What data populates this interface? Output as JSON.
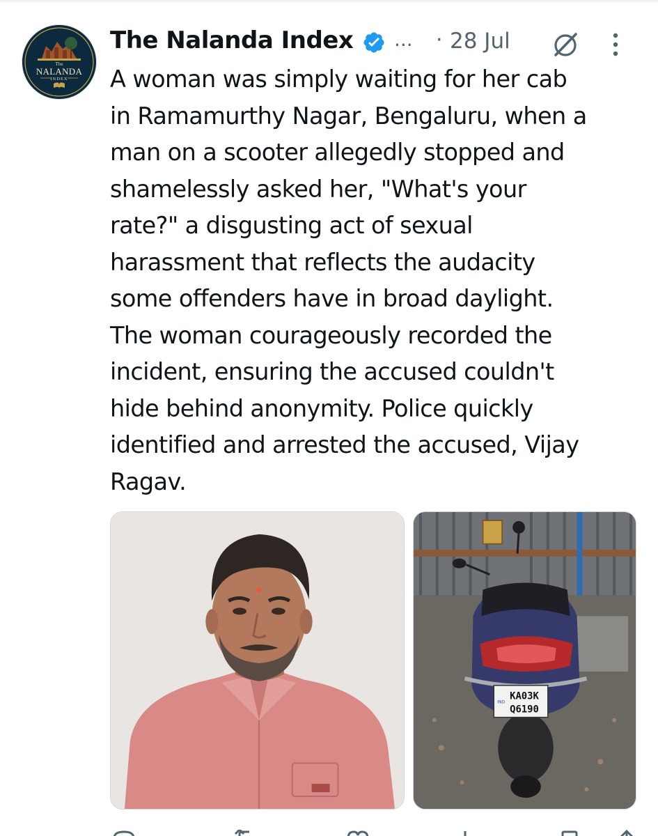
{
  "tweet": {
    "author_name": "The Nalanda Index",
    "handle_truncated": "...",
    "separator": "·",
    "date": "28 Jul",
    "text_lines": [
      "A woman was simply waiting for her cab",
      "in Ramamurthy Nagar, Bengaluru, when a",
      "man on a scooter allegedly stopped and",
      "shamelessly asked her, \"What's your",
      "rate?\" a disgusting act of sexual",
      "harassment that reflects the audacity",
      "some offenders have in broad daylight.",
      "The woman courageously recorded the",
      "incident, ensuring the accused couldn't",
      "hide behind anonymity. Police quickly",
      "identified and arrested the accused, Vijay",
      "Ragav."
    ]
  },
  "avatar": {
    "logo_top": "The",
    "logo_main": "NALANDA",
    "logo_sub": "INDEX"
  },
  "media": {
    "plate_line1": "KA03K",
    "plate_line2": "Q6190",
    "plate_side": "IND"
  },
  "icons": {
    "verified": "verified-badge-icon",
    "grok": "grok-icon",
    "more": "more-vertical-icon",
    "reply": "reply-icon",
    "retweet": "retweet-icon",
    "like": "heart-icon",
    "views": "views-icon",
    "bookmark": "bookmark-icon",
    "share": "share-icon"
  },
  "colors": {
    "text": "#0f1419",
    "secondary": "#536471",
    "verified": "#1d9bf0",
    "avatar_bg": "#0b2a3d"
  }
}
